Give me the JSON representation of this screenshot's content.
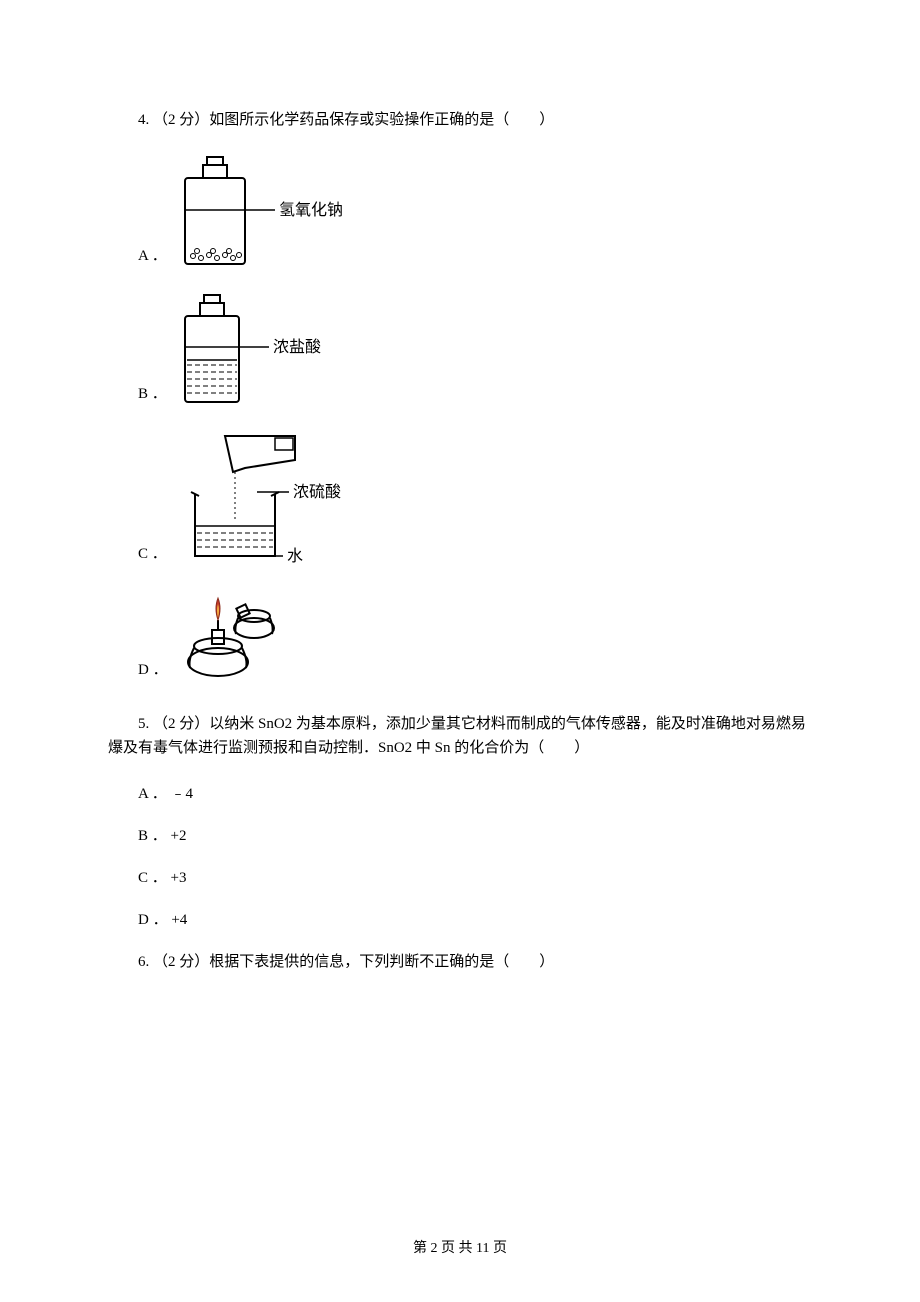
{
  "q4": {
    "header": "4.  （2 分）如图所示化学药品保存或实验操作正确的是（　　）",
    "options": {
      "A": {
        "label": "A ．",
        "diagram_label": "氢氧化钠"
      },
      "B": {
        "label": "B ．",
        "diagram_label": "浓盐酸"
      },
      "C": {
        "label": "C ．",
        "diagram_label_top": "浓硫酸",
        "diagram_label_bottom": "水"
      },
      "D": {
        "label": "D ．"
      }
    }
  },
  "q5": {
    "line1": "5.  （2 分）以纳米 SnO2 为基本原料，添加少量其它材料而制成的气体传感器，能及时准确地对易燃易",
    "line2": "爆及有毒气体进行监测预报和自动控制．SnO2 中 Sn 的化合价为（　　）",
    "options": {
      "A": "A ． ﹣4",
      "B": "B ． +2",
      "C": "C ． +3",
      "D": "D ． +4"
    }
  },
  "q6": {
    "header": "6.  （2 分）根据下表提供的信息，下列判断不正确的是（　　）"
  },
  "footer": "第 2 页 共 11 页"
}
